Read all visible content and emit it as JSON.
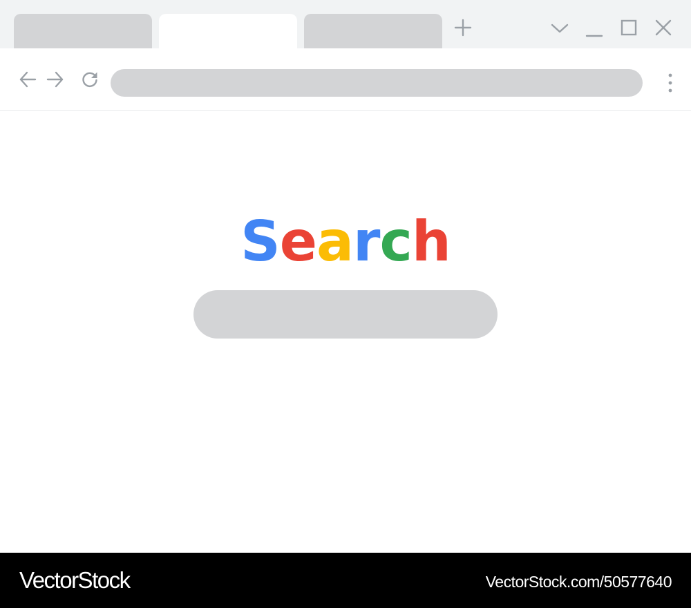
{
  "tabs": [
    {
      "label": "",
      "active": false
    },
    {
      "label": "",
      "active": true
    },
    {
      "label": "",
      "active": false
    }
  ],
  "icons": {
    "new_tab": "plus-icon",
    "tab_list": "chevron-down-icon",
    "minimize": "minimize-icon",
    "maximize": "maximize-icon",
    "close": "close-icon",
    "back": "arrow-left-icon",
    "forward": "arrow-right-icon",
    "reload": "reload-icon",
    "menu": "more-vertical-icon"
  },
  "address_bar": {
    "value": "",
    "placeholder": ""
  },
  "logo": {
    "letters": [
      {
        "char": "S",
        "color": "#4285f4"
      },
      {
        "char": "e",
        "color": "#ea4335"
      },
      {
        "char": "a",
        "color": "#fbbc05"
      },
      {
        "char": "r",
        "color": "#4285f4"
      },
      {
        "char": "c",
        "color": "#34a853"
      },
      {
        "char": "h",
        "color": "#ea4335"
      }
    ]
  },
  "search_box": {
    "value": "",
    "placeholder": ""
  },
  "watermark": {
    "brand": "VectorStock",
    "url": "VectorStock.com/50577640"
  },
  "colors": {
    "tab_strip": "#f1f3f4",
    "placeholder_gray": "#d3d4d6",
    "icon_gray": "#9aa0a6",
    "footer": "#000000"
  }
}
